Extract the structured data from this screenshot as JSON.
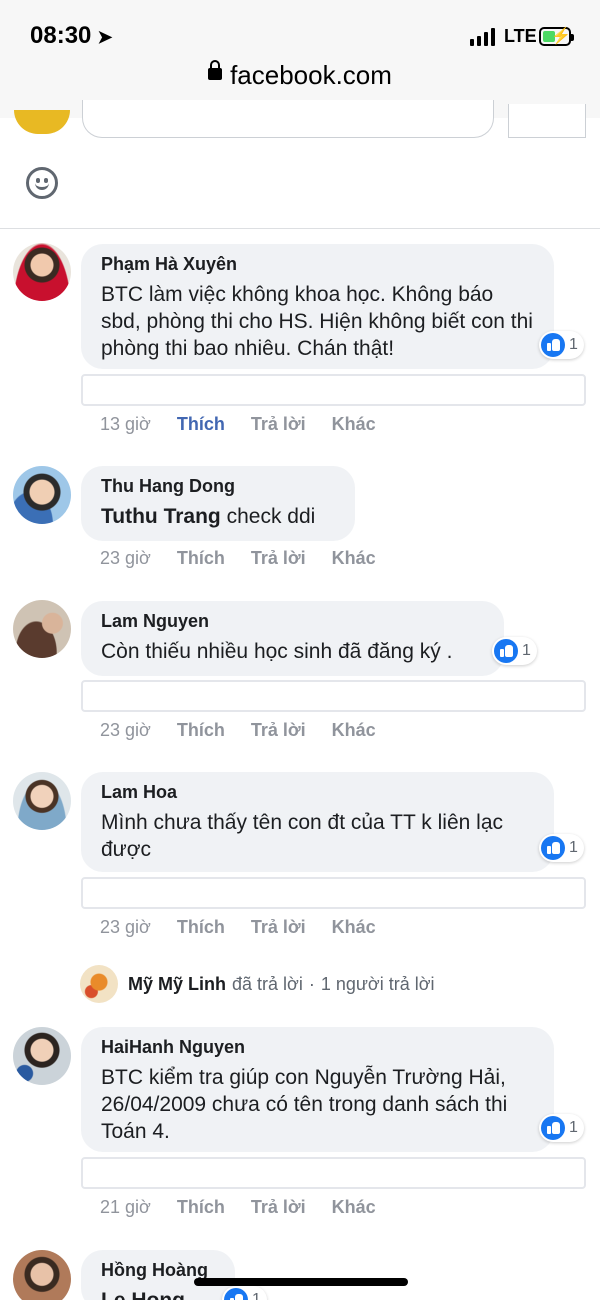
{
  "status_bar": {
    "time": "08:30",
    "network": "LTE"
  },
  "browser": {
    "url": "facebook.com"
  },
  "colors": {
    "link_blue": "#4267b2",
    "like_blue": "#1877f2",
    "bubble_bg": "#f0f2f5",
    "meta_gray": "#90949c"
  },
  "comments": [
    {
      "author": "Phạm Hà Xuyên",
      "text": "BTC làm việc không khoa học. Không báo sbd, phòng thi cho HS. Hiện không biết con thi phòng thi bao nhiêu. Chán thật!",
      "reactions": "1",
      "time": "13 giờ",
      "like": "Thích",
      "reply": "Trả lời",
      "more": "Khác"
    },
    {
      "author": "Thu Hang Dong",
      "mention": "Tuthu Trang",
      "text": " check ddi",
      "time": "23 giờ",
      "like": "Thích",
      "reply": "Trả lời",
      "more": "Khác"
    },
    {
      "author": "Lam Nguyen",
      "text": "Còn thiếu nhiều học sinh đã đăng ký .",
      "reactions": "1",
      "time": "23 giờ",
      "like": "Thích",
      "reply": "Trả lời",
      "more": "Khác"
    },
    {
      "author": "Lam Hoa",
      "text": "Mình chưa thấy tên con đt của TT k liên lạc được",
      "reactions": "1",
      "time": "23 giờ",
      "like": "Thích",
      "reply": "Trả lời",
      "more": "Khác",
      "replies": {
        "name": "Mỹ Mỹ Linh",
        "action": "đã trả lời",
        "count": "1 người trả lời"
      }
    },
    {
      "author": "HaiHanh Nguyen",
      "text": "BTC kiểm tra giúp con Nguyễn Trường Hải, 26/04/2009 chưa có tên trong danh sách thi Toán 4.",
      "reactions": "1",
      "time": "21 giờ",
      "like": "Thích",
      "reply": "Trả lời",
      "more": "Khác"
    },
    {
      "author": "Hồng Hoàng",
      "text": "Le Hong",
      "reactions": "1"
    }
  ]
}
